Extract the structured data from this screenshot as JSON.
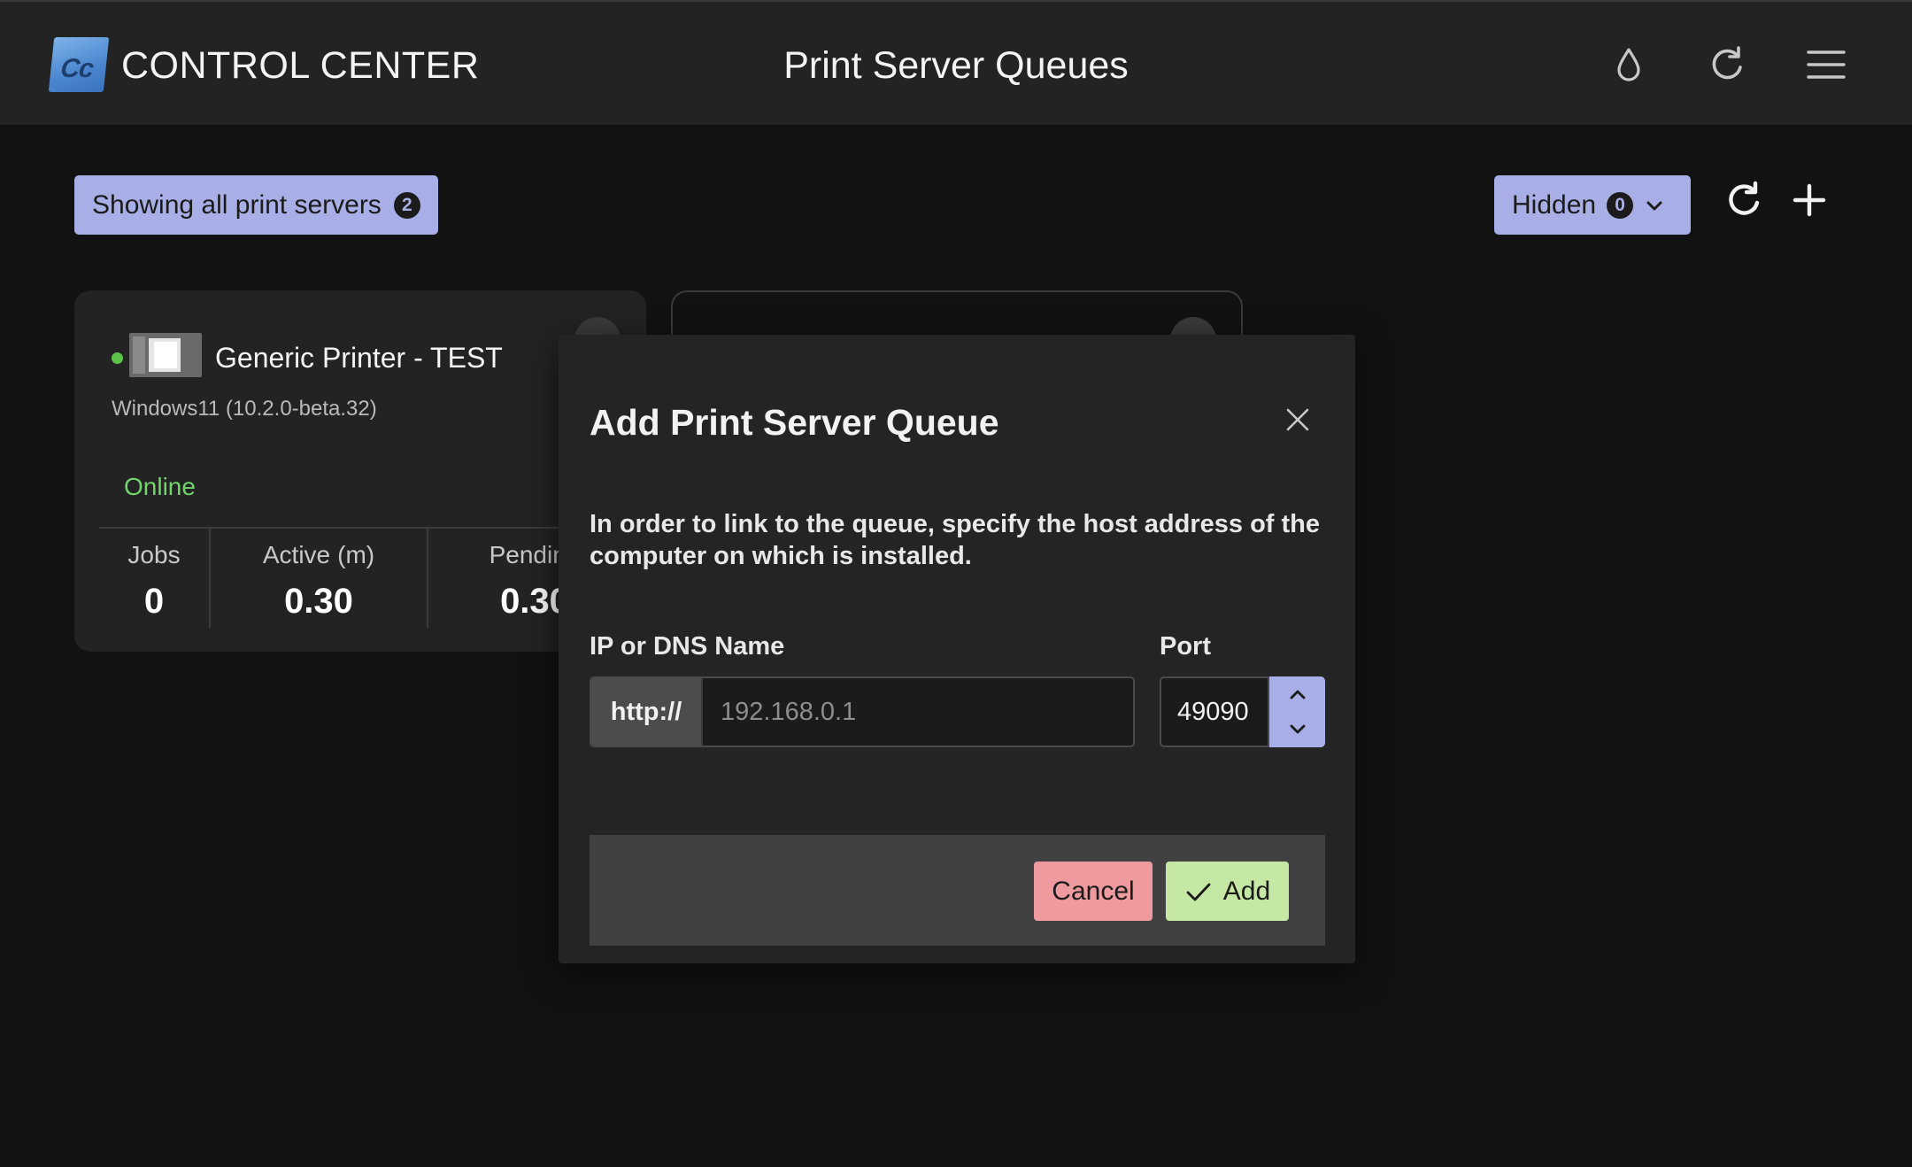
{
  "header": {
    "logo_text": "Cc",
    "app_title": "CONTROL CENTER",
    "page_title": "Print Server Queues",
    "icons": [
      "droplet-icon",
      "refresh-icon",
      "menu-icon"
    ]
  },
  "toolbar": {
    "filter_label": "Showing all print servers",
    "filter_count": "2",
    "hidden_label": "Hidden",
    "hidden_count": "0",
    "icons": [
      "chevron-down-icon",
      "refresh-icon",
      "plus-icon"
    ]
  },
  "printer_card": {
    "name": "Generic Printer - TEST",
    "subtitle": "Windows11 (10.2.0-beta.32)",
    "status": "Online",
    "stats": [
      {
        "label": "Jobs",
        "unit": "",
        "value": "0"
      },
      {
        "label": "Active",
        "unit": "(m)",
        "value": "0.30"
      },
      {
        "label": "Pending",
        "unit": "",
        "value": "0.30"
      }
    ]
  },
  "modal": {
    "title": "Add Print Server Queue",
    "description": "In order to link to the queue, specify the host address of the computer on which is installed.",
    "address_label": "IP or DNS Name",
    "address_prefix": "http://",
    "address_placeholder": "192.168.0.1",
    "address_value": "",
    "port_label": "Port",
    "port_value": "49090",
    "cancel_label": "Cancel",
    "add_label": "Add"
  },
  "colors": {
    "background": "#121212",
    "header": "#232323",
    "chip": "#a8afe6",
    "online": "#71d66a",
    "cancel": "#ee9a9e",
    "add": "#c5e8a4"
  }
}
